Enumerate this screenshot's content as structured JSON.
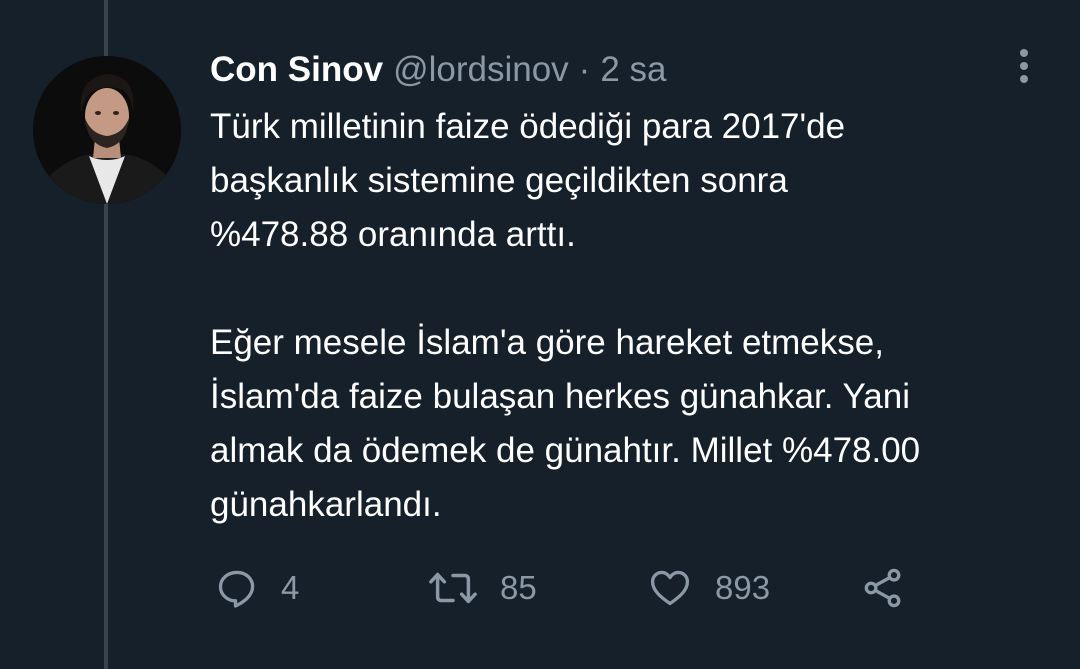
{
  "tweet": {
    "author": {
      "display_name": "Con Sinov",
      "handle": "@lordsinov",
      "separator": "·",
      "time": "2 sa"
    },
    "paragraphs": [
      "Türk milletinin faize ödediği para 2017'de\nbaşkanlık sistemine geçildikten sonra\n%478.88 oranında arttı.",
      "Eğer mesele İslam'a göre hareket etmekse,\nİslam'da faize bulaşan herkes günahkar. Yani\nalmak da ödemek de günahtır. Millet %478.00\ngünahkarlandı."
    ],
    "stats": {
      "replies": "4",
      "retweets": "85",
      "likes": "893"
    }
  },
  "icons": {
    "more": "more-vertical-icon",
    "reply": "reply-icon",
    "retweet": "retweet-icon",
    "like": "heart-icon",
    "share": "share-icon"
  },
  "colors": {
    "background": "#15202b",
    "primary_text": "#ffffff",
    "secondary_text": "#8b98a5",
    "thread_line": "#38444d"
  }
}
